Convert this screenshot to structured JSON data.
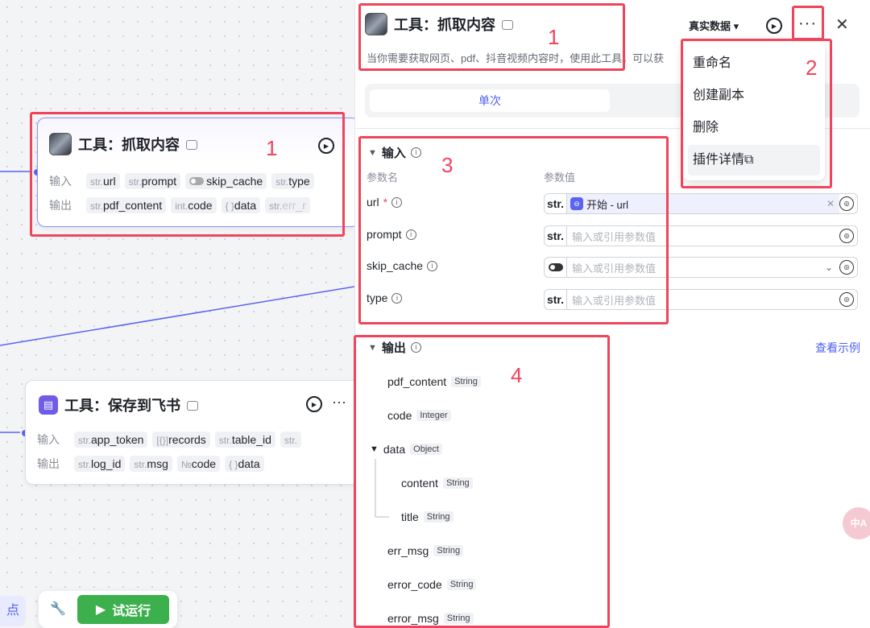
{
  "canvas": {
    "node1": {
      "title": "工具：抓取内容",
      "input_label": "输入",
      "output_label": "输出",
      "inputs": [
        {
          "type": "str.",
          "name": "url"
        },
        {
          "type": "str.",
          "name": "prompt"
        },
        {
          "type": "",
          "name": "skip_cache"
        },
        {
          "type": "str.",
          "name": "type"
        }
      ],
      "outputs": [
        {
          "type": "str.",
          "name": "pdf_content"
        },
        {
          "type": "int.",
          "name": "code"
        },
        {
          "type": "{ }",
          "name": "data"
        },
        {
          "type": "str.",
          "name": "err_r"
        }
      ]
    },
    "node2": {
      "title": "工具：保存到飞书",
      "input_label": "输入",
      "output_label": "输出",
      "more": "···",
      "inputs": [
        {
          "type": "str.",
          "name": "app_token"
        },
        {
          "type": "[{}]",
          "name": "records"
        },
        {
          "type": "str.",
          "name": "table_id"
        },
        {
          "type": "str.",
          "name": ""
        }
      ],
      "outputs": [
        {
          "type": "str.",
          "name": "log_id"
        },
        {
          "type": "str.",
          "name": "msg"
        },
        {
          "type": "№",
          "name": "code"
        },
        {
          "type": "{ }",
          "name": "data"
        }
      ]
    },
    "bottom": {
      "left_fragment": "点",
      "run_label": "试运行"
    },
    "float_label": "中A"
  },
  "panel": {
    "title": "工具：抓取内容",
    "description": "当你需要获取网页、pdf、抖音视频内容时，使用此工具。可以获",
    "data_mode": "真实数据 ▾",
    "more": "···",
    "close": "✕",
    "tab_single": "单次",
    "input_section": {
      "title": "输入",
      "col_name": "参数名",
      "col_value": "参数值",
      "params": [
        {
          "name": "url",
          "required": true,
          "prefix": "str.",
          "ref": "开始 - url"
        },
        {
          "name": "prompt",
          "required": false,
          "prefix": "str.",
          "placeholder": "输入或引用参数值"
        },
        {
          "name": "skip_cache",
          "required": false,
          "prefix": "toggle",
          "placeholder": "输入或引用参数值"
        },
        {
          "name": "type",
          "required": false,
          "prefix": "str.",
          "placeholder": "输入或引用参数值"
        }
      ]
    },
    "output_section": {
      "title": "输出",
      "example_link": "查看示例",
      "items": [
        {
          "name": "pdf_content",
          "type": "String"
        },
        {
          "name": "code",
          "type": "Integer"
        },
        {
          "name": "data",
          "type": "Object"
        },
        {
          "name": "content",
          "type": "String"
        },
        {
          "name": "title",
          "type": "String"
        },
        {
          "name": "err_msg",
          "type": "String"
        },
        {
          "name": "error_code",
          "type": "String"
        },
        {
          "name": "error_msg",
          "type": "String"
        }
      ]
    }
  },
  "dropdown": {
    "items": [
      "重命名",
      "创建副本",
      "删除",
      "插件详情⧉"
    ]
  },
  "annotations": [
    "1",
    "1",
    "2",
    "3",
    "4"
  ],
  "colors": {
    "accent": "#4e5ff2",
    "annotation_red": "#f0445c",
    "run_green": "#3cb04c"
  }
}
